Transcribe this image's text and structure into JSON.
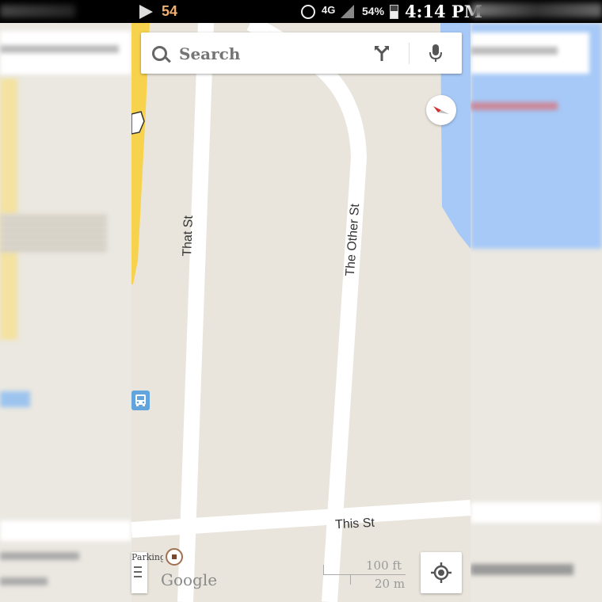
{
  "status_bar": {
    "notification_count": "54",
    "network_label": "4G",
    "battery_percent": "54%",
    "time": "4:14 PM"
  },
  "search": {
    "placeholder": "Search"
  },
  "map": {
    "road_labels": {
      "that_st": "That St",
      "the_other_st": "The Other St",
      "this_st": "This St"
    },
    "poi_label": "Parking",
    "google_logo": "Google",
    "scale": {
      "top": "100 ft",
      "bottom": "20 m"
    },
    "colors": {
      "land": "#e9e5dc",
      "road": "#ffffff",
      "water": "#a6c9f7",
      "highway": "#f6d24d",
      "transit": "#62a5dc"
    }
  },
  "icons": {
    "search": "search-icon",
    "directions": "directions-icon",
    "mic": "mic-icon",
    "compass": "compass-icon",
    "bus": "bus-icon",
    "menu": "menu-icon",
    "my_location": "my-location-icon"
  }
}
